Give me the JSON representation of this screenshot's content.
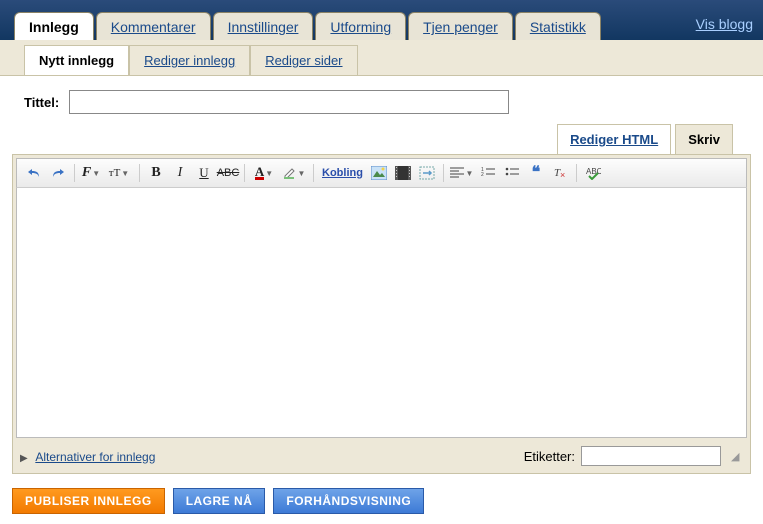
{
  "main_tabs": {
    "innlegg": "Innlegg",
    "kommentarer": "Kommentarer",
    "innstillinger": "Innstillinger",
    "utforming": "Utforming",
    "tjen_penger": "Tjen penger",
    "statistikk": "Statistikk"
  },
  "vis_blogg": "Vis blogg",
  "sub_tabs": {
    "nytt_innlegg": "Nytt innlegg",
    "rediger_innlegg": "Rediger innlegg",
    "rediger_sider": "Rediger sider"
  },
  "title_label": "Tittel:",
  "title_value": "",
  "mode_tabs": {
    "rediger_html": "Rediger HTML",
    "skriv": "Skriv"
  },
  "toolbar": {
    "link_label": "Kobling",
    "font_family_sample": "F",
    "font_size_sample": "тT",
    "bold": "B",
    "italic": "I",
    "underline": "U",
    "strike": "ABC",
    "textcolor": "A"
  },
  "options_link": "Alternativer for innlegg",
  "etiketter_label": "Etiketter:",
  "etiketter_value": "",
  "buttons": {
    "publiser": "PUBLISER INNLEGG",
    "lagre": "LAGRE NÅ",
    "forhandsvisning": "FORHÅNDSVISNING"
  }
}
